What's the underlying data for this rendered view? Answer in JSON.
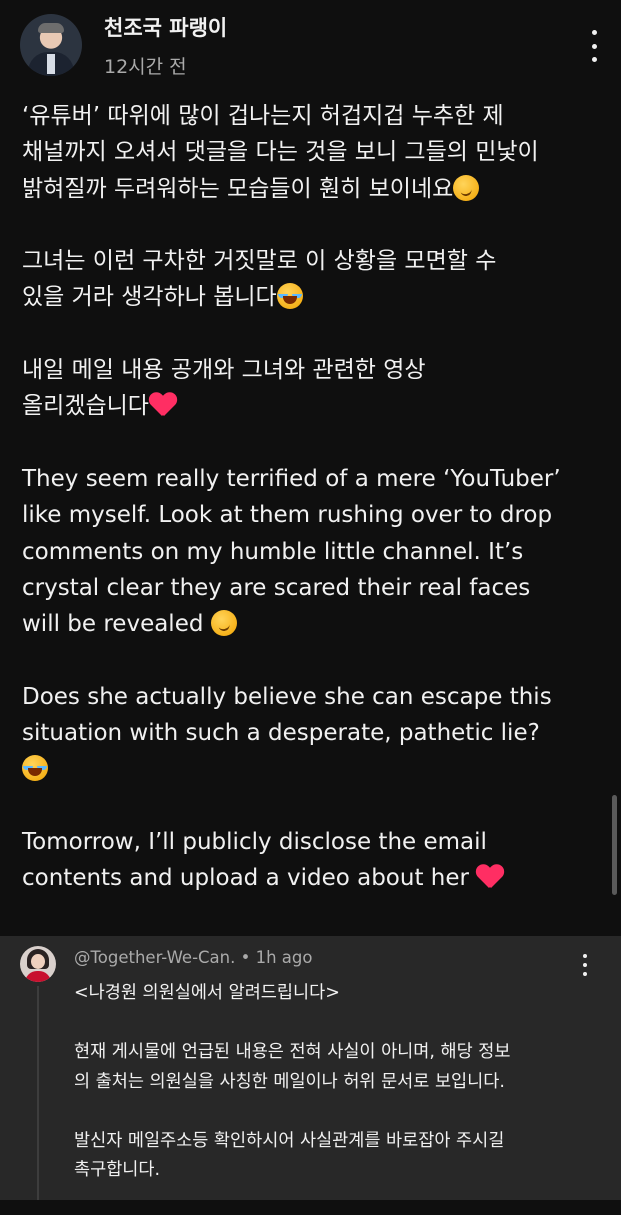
{
  "post": {
    "author": "천조국 파랭이",
    "timestamp": "12시간 전",
    "menu_icon": "more-vertical-icon",
    "paragraphs": [
      {
        "lines": [
          "‘유튜버’ 따위에 많이 겁나는지 허겁지겁 누추한 제",
          "채널까지 오셔서 댓글을 다는 것을 보니 그들의 민낯이",
          "밝혀질까 두려워하는 모습들이 훤히 보이네요"
        ],
        "emoji": "smirking-face"
      },
      {
        "lines": [
          "그녀는 이런 구차한 거짓말로 이 상황을 모면할 수",
          "있을 거라 생각하나 봅니다"
        ],
        "emoji": "tears-of-joy"
      },
      {
        "lines": [
          "내일 메일 내용 공개와 그녀와 관련한 영상",
          "올리겠습니다"
        ],
        "emoji": "red-heart"
      },
      {
        "lines": [
          "They seem really terrified of a mere ‘YouTuber’",
          "like myself. Look at them rushing over to drop",
          "comments on my humble little channel. It’s",
          "crystal clear they are scared their real faces",
          "will be revealed "
        ],
        "emoji": "smirking-face"
      },
      {
        "lines": [
          "Does she actually believe she can escape this",
          "situation with such a desperate, pathetic lie?",
          ""
        ],
        "emoji": "tears-of-joy"
      },
      {
        "lines": [
          "Tomorrow, I’ll publicly disclose the email",
          "contents and upload a video about her "
        ],
        "emoji": "red-heart"
      }
    ]
  },
  "reply": {
    "handle": "@Together-We-Can.",
    "separator": "•",
    "timestamp": "1h ago",
    "menu_icon": "more-vertical-icon",
    "paragraphs": [
      [
        "<나경원 의원실에서 알려드립니다>"
      ],
      [
        "현재 게시물에 언급된 내용은 전혀 사실이 아니며, 해당 정보",
        "의 출처는 의원실을 사칭한 메일이나 허위 문서로 보입니다."
      ],
      [
        "발신자 메일주소등 확인하시어 사실관계를 바로잡아 주시길",
        "촉구합니다."
      ]
    ]
  },
  "colors": {
    "background": "#0f0f0f",
    "reply_background": "#282828",
    "text_primary": "#f1f1f1",
    "text_secondary": "#aaaaaa",
    "heart": "#ff2e63"
  }
}
